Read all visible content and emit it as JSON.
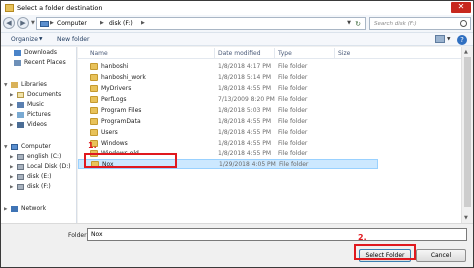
{
  "window": {
    "title": "Select a folder destination",
    "close_glyph": "✕"
  },
  "address": {
    "crumbs": [
      "Computer",
      "disk (F:)"
    ],
    "search_placeholder": "Search disk (F:)",
    "back_glyph": "◀",
    "forward_glyph": "▶",
    "refresh_glyph": "↻"
  },
  "toolbar": {
    "organize_label": "Organize",
    "new_folder_label": "New folder",
    "help_glyph": "?"
  },
  "nav": {
    "items": [
      {
        "label": "Downloads",
        "icon": "downloads-icon"
      },
      {
        "label": "Recent Places",
        "icon": "recent-places-icon"
      },
      {
        "label": "Libraries",
        "icon": "libraries-icon"
      },
      {
        "label": "Documents",
        "icon": "documents-icon"
      },
      {
        "label": "Music",
        "icon": "music-icon"
      },
      {
        "label": "Pictures",
        "icon": "pictures-icon"
      },
      {
        "label": "Videos",
        "icon": "videos-icon"
      },
      {
        "label": "Computer",
        "icon": "computer-icon"
      },
      {
        "label": "english (C:)",
        "icon": "drive-icon"
      },
      {
        "label": "Local Disk (D:)",
        "icon": "drive-icon"
      },
      {
        "label": "disk (E:)",
        "icon": "drive-icon"
      },
      {
        "label": "disk (F:)",
        "icon": "drive-icon"
      },
      {
        "label": "Network",
        "icon": "network-icon"
      }
    ]
  },
  "columns": {
    "name": "Name",
    "date": "Date modified",
    "type": "Type",
    "size": "Size"
  },
  "files": [
    {
      "name": "hanboshi",
      "date": "1/8/2018 4:17 PM",
      "type": "File folder"
    },
    {
      "name": "hanboshi_work",
      "date": "1/8/2018 5:14 PM",
      "type": "File folder"
    },
    {
      "name": "MyDrivers",
      "date": "1/8/2018 4:55 PM",
      "type": "File folder"
    },
    {
      "name": "PerfLogs",
      "date": "7/13/2009 8:20 PM",
      "type": "File folder"
    },
    {
      "name": "Program Files",
      "date": "1/8/2018 5:03 PM",
      "type": "File folder"
    },
    {
      "name": "ProgramData",
      "date": "1/8/2018 4:55 PM",
      "type": "File folder"
    },
    {
      "name": "Users",
      "date": "1/8/2018 4:55 PM",
      "type": "File folder"
    },
    {
      "name": "Windows",
      "date": "1/8/2018 4:55 PM",
      "type": "File folder"
    },
    {
      "name": "Windows.old",
      "date": "1/8/2018 4:55 PM",
      "type": "File folder"
    },
    {
      "name": "Nox",
      "date": "1/29/2018 4:05 PM",
      "type": "File folder"
    }
  ],
  "selected_file_index": 9,
  "bottom": {
    "folder_label": "Folder:",
    "folder_value": "Nox",
    "select_button": "Select Folder",
    "cancel_button": "Cancel"
  },
  "annotations": {
    "step1": "1.",
    "step2": "2."
  },
  "colors": {
    "highlight": "#e0191f",
    "selection": "#cce8ff",
    "folder": "#e8c25a"
  }
}
